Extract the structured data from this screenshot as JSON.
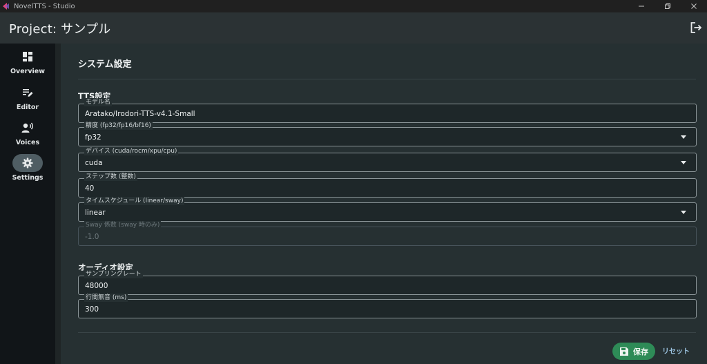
{
  "window": {
    "title": "NovelTTS - Studio",
    "minimize_icon": "minimize-icon",
    "restore_icon": "restore-icon",
    "close_icon": "close-icon"
  },
  "header": {
    "project_title": "Project: サンプル",
    "logout_icon": "logout-icon"
  },
  "sidebar": {
    "items": [
      {
        "label": "Overview",
        "icon": "dashboard-icon",
        "active": false
      },
      {
        "label": "Editor",
        "icon": "edit-list-icon",
        "active": false
      },
      {
        "label": "Voices",
        "icon": "voice-person-icon",
        "active": false
      },
      {
        "label": "Settings",
        "icon": "gear-icon",
        "active": true
      }
    ]
  },
  "main": {
    "page_title": "システム設定",
    "tts_section": {
      "title": "TTS設定",
      "model": {
        "label": "モデル名",
        "value": "Aratako/Irodori-TTS-v4.1-Small"
      },
      "precision": {
        "label": "精度 (fp32/fp16/bf16)",
        "value": "fp32"
      },
      "device": {
        "label": "デバイス (cuda/rocm/xpu/cpu)",
        "value": "cuda"
      },
      "steps": {
        "label": "ステップ数 (整数)",
        "value": "40"
      },
      "schedule": {
        "label": "タイムスケジュール (linear/sway)",
        "value": "linear"
      },
      "sway": {
        "label": "Sway 係数 (sway 時のみ)",
        "value": "-1.0",
        "disabled": true
      }
    },
    "audio_section": {
      "title": "オーディオ設定",
      "sample_rate": {
        "label": "サンプリングレート",
        "value": "48000"
      },
      "line_silence": {
        "label": "行間無音 (ms)",
        "value": "300"
      }
    },
    "actions": {
      "save_label": "保存",
      "reset_label": "リセット"
    }
  },
  "colors": {
    "accent_green": "#2e8b57",
    "link_blue": "#9cc3e0",
    "sidebar_bg": "#111518",
    "main_bg": "#263032"
  }
}
